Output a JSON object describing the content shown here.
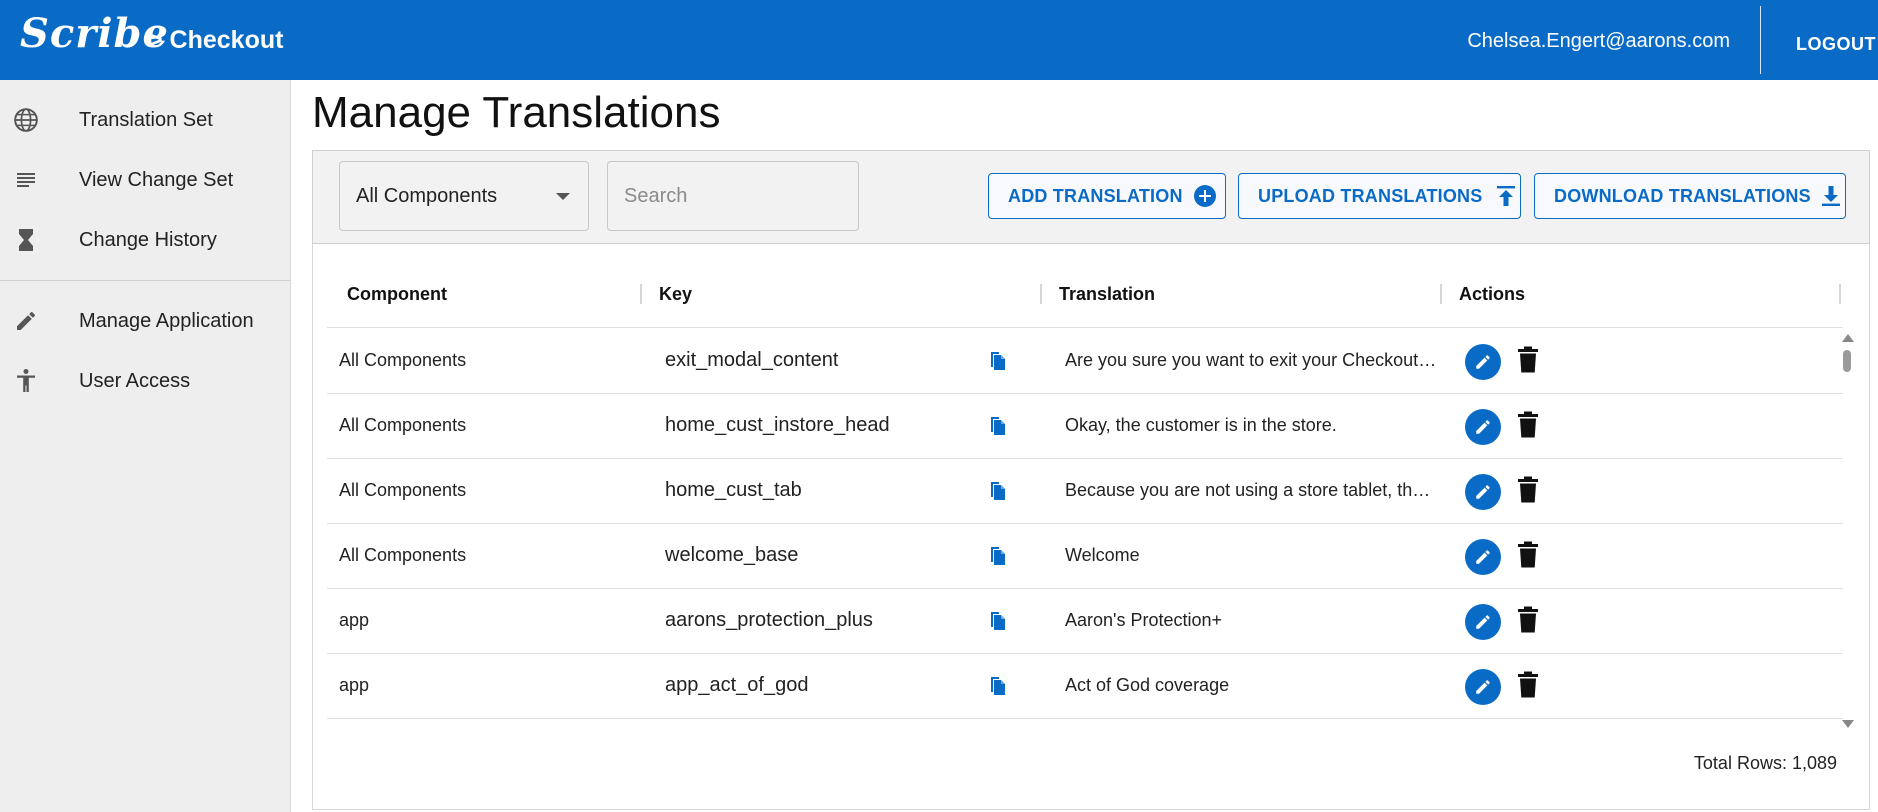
{
  "header": {
    "brand": "Scribe",
    "breadcrumb": "> Checkout",
    "user_email": "Chelsea.Engert@aarons.com",
    "logout_label": "LOGOUT"
  },
  "sidebar": {
    "items": [
      {
        "label": "Translation Set",
        "icon": "globe-icon"
      },
      {
        "label": "View Change Set",
        "icon": "list-icon"
      },
      {
        "label": "Change History",
        "icon": "hourglass-icon"
      },
      {
        "label": "Manage Application",
        "icon": "pencil-icon"
      },
      {
        "label": "User Access",
        "icon": "accessibility-icon"
      }
    ]
  },
  "main": {
    "title": "Manage Translations",
    "component_filter": {
      "selected": "All Components"
    },
    "search": {
      "placeholder": "Search",
      "value": ""
    },
    "buttons": {
      "add": "ADD TRANSLATION",
      "upload": "UPLOAD TRANSLATIONS",
      "download": "DOWNLOAD TRANSLATIONS"
    },
    "table": {
      "columns": [
        "Component",
        "Key",
        "Translation",
        "Actions"
      ],
      "rows": [
        {
          "component": "All Components",
          "key": "exit_modal_content",
          "translation": "Are you sure you want to exit your Checkout …"
        },
        {
          "component": "All Components",
          "key": "home_cust_instore_head",
          "translation": "Okay, the customer is in the store."
        },
        {
          "component": "All Components",
          "key": "home_cust_tab",
          "translation": "Because you are not using a store tablet, the …"
        },
        {
          "component": "All Components",
          "key": "welcome_base",
          "translation": "Welcome"
        },
        {
          "component": "app",
          "key": "aarons_protection_plus",
          "translation": "Aaron's Protection+"
        },
        {
          "component": "app",
          "key": "app_act_of_god",
          "translation": "Act of God coverage"
        }
      ]
    },
    "total_rows": "Total Rows: 1,089"
  },
  "colors": {
    "primary": "#0a6bc6",
    "sidebar_bg": "#eeeeee",
    "toolbar_bg": "#f2f2f2"
  }
}
